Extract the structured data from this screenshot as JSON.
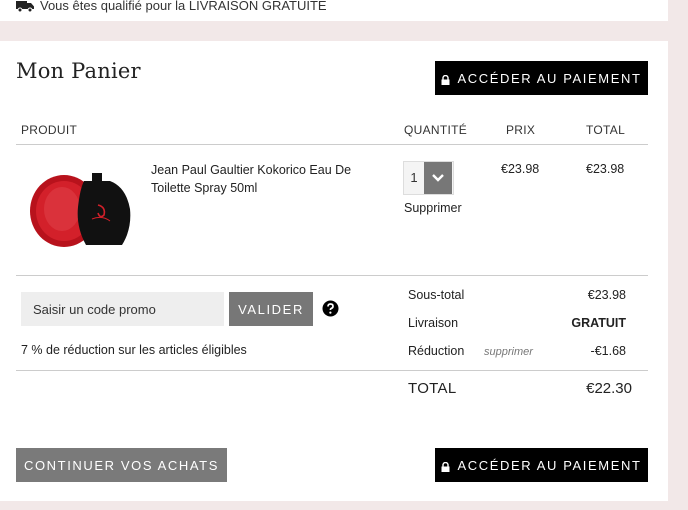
{
  "shipping_banner": {
    "text": "Vous êtes qualifié pour la LIVRAISON GRATUITE",
    "icon": "truck-icon"
  },
  "cart": {
    "title": "Mon Panier",
    "checkout_label": "ACCÉDER AU PAIEMENT",
    "columns": {
      "product": "PRODUIT",
      "quantity": "QUANTITÉ",
      "price": "PRIX",
      "total": "TOTAL"
    },
    "items": [
      {
        "name": "Jean Paul Gaultier Kokorico Eau De Toilette Spray 50ml",
        "quantity": "1",
        "remove_label": "Supprimer",
        "price": "€23.98",
        "total": "€23.98"
      }
    ]
  },
  "promo": {
    "placeholder": "Saisir un code promo",
    "apply_label": "VALIDER",
    "discount_note": "7 % de réduction sur les articles éligibles"
  },
  "summary": {
    "subtotal_label": "Sous-total",
    "subtotal_value": "€23.98",
    "shipping_label": "Livraison",
    "shipping_value": "GRATUIT",
    "discount_label": "Réduction",
    "discount_remove": "supprimer",
    "discount_value": "-€1.68",
    "total_label": "TOTAL",
    "total_value": "€22.30"
  },
  "footer": {
    "continue_label": "CONTINUER VOS ACHATS",
    "checkout_label": "ACCÉDER AU PAIEMENT"
  },
  "colors": {
    "background": "#f2e8e8",
    "primary_button": "#000000",
    "secondary_button": "#777777"
  }
}
